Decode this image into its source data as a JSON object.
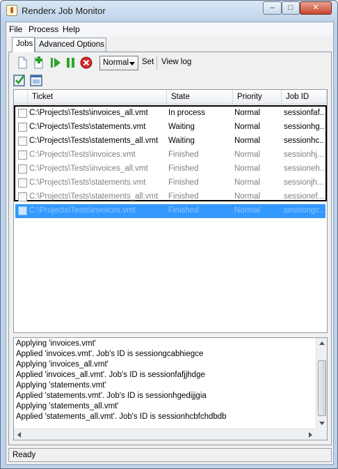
{
  "window": {
    "title": "Renderx Job Monitor"
  },
  "menu": {
    "items": [
      "File",
      "Process",
      "Help"
    ]
  },
  "tabs": [
    "Jobs",
    "Advanced Options"
  ],
  "toolbar": {
    "priority_value": "Normal",
    "set_label": "Set",
    "view_log_label": "View log",
    "icons": [
      "new-document-icon",
      "add-document-icon",
      "play-icon",
      "pause-icon",
      "stop-icon",
      "check-all-icon",
      "select-window-icon"
    ]
  },
  "table": {
    "headers": [
      "Ticket",
      "State",
      "Priority",
      "Job ID"
    ],
    "rows": [
      {
        "ticket": "C:\\Projects\\Tests\\invoices_all.vmt",
        "state": "In process",
        "priority": "Normal",
        "job_id": "sessionfaf...",
        "status": "active"
      },
      {
        "ticket": "C:\\Projects\\Tests\\statements.vmt",
        "state": "Waiting",
        "priority": "Normal",
        "job_id": "sessionhg...",
        "status": "active"
      },
      {
        "ticket": "C:\\Projects\\Tests\\statements_all.vmt",
        "state": "Waiting",
        "priority": "Normal",
        "job_id": "sessionhc...",
        "status": "active"
      },
      {
        "ticket": "C:\\Projects\\Tests\\invoices.vmt",
        "state": "Finished",
        "priority": "Normal",
        "job_id": "sessionhj...",
        "status": "finished"
      },
      {
        "ticket": "C:\\Projects\\Tests\\invoices_all.vmt",
        "state": "Finished",
        "priority": "Normal",
        "job_id": "sessioneh...",
        "status": "finished"
      },
      {
        "ticket": "C:\\Projects\\Tests\\statements.vmt",
        "state": "Finished",
        "priority": "Normal",
        "job_id": "sessionjh...",
        "status": "finished"
      },
      {
        "ticket": "C:\\Projects\\Tests\\statements_all.vmt",
        "state": "Finished",
        "priority": "Normal",
        "job_id": "sessionef...",
        "status": "finished"
      },
      {
        "ticket": "C:\\Projects\\Tests\\invoices.vmt",
        "state": "Finished",
        "priority": "Normal",
        "job_id": "sessiongc...",
        "status": "selected"
      }
    ]
  },
  "log": {
    "lines": [
      "Applying 'invoices.vmt'",
      "Applied 'invoices.vmt'. Job's ID is sessiongcabhiegce",
      "Applying 'invoices_all.vmt'",
      "Applied 'invoices_all.vmt'. Job's ID is sessionfafjjhdge",
      "Applying 'statements.vmt'",
      "Applied 'statements.vmt'. Job's ID is sessionhgedijjgia",
      "Applying 'statements_all.vmt'",
      "Applied 'statements_all.vmt'. Job's ID is sessionhcbfchdbdb"
    ]
  },
  "status": {
    "text": "Ready"
  },
  "colors": {
    "selection": "#3399ff",
    "finished_text": "#808080"
  }
}
